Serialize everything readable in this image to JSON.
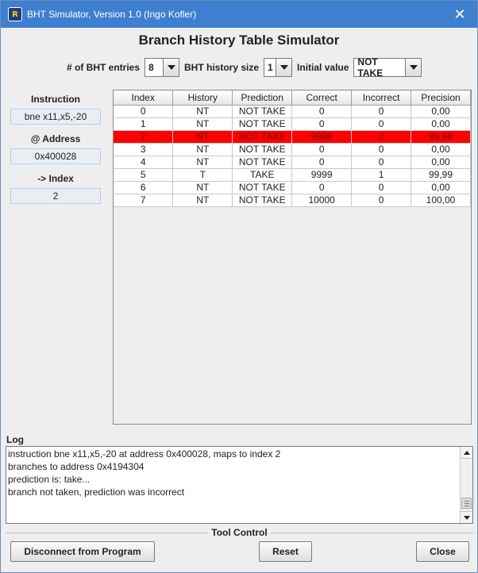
{
  "window": {
    "title": "BHT Simulator, Version 1.0 (Ingo Kofler)",
    "close_glyph": "✕"
  },
  "heading": "Branch History Table Simulator",
  "options": {
    "bht_entries_label": "# of BHT entries",
    "bht_entries_value": "8",
    "history_size_label": "BHT history size",
    "history_size_value": "1",
    "initial_value_label": "Initial value",
    "initial_value_value": "NOT TAKE"
  },
  "left_panel": {
    "instruction_label": "Instruction",
    "instruction_value": "bne x11,x5,-20",
    "address_label": "@ Address",
    "address_value": "0x400028",
    "index_label": "-> Index",
    "index_value": "2"
  },
  "table": {
    "headers": [
      "Index",
      "History",
      "Prediction",
      "Correct",
      "Incorrect",
      "Precision"
    ],
    "selected_row": 2,
    "selected_color": "#ff0000",
    "rows": [
      [
        "0",
        "NT",
        "NOT TAKE",
        "0",
        "0",
        "0,00"
      ],
      [
        "1",
        "NT",
        "NOT TAKE",
        "0",
        "0",
        "0,00"
      ],
      [
        "2",
        "NT",
        "NOT TAKE",
        "9998",
        "2",
        "99,98"
      ],
      [
        "3",
        "NT",
        "NOT TAKE",
        "0",
        "0",
        "0,00"
      ],
      [
        "4",
        "NT",
        "NOT TAKE",
        "0",
        "0",
        "0,00"
      ],
      [
        "5",
        "T",
        "TAKE",
        "9999",
        "1",
        "99,99"
      ],
      [
        "6",
        "NT",
        "NOT TAKE",
        "0",
        "0",
        "0,00"
      ],
      [
        "7",
        "NT",
        "NOT TAKE",
        "10000",
        "0",
        "100,00"
      ]
    ]
  },
  "log": {
    "label": "Log",
    "lines": [
      "instruction bne x11,x5,-20 at address 0x400028, maps to index 2",
      "branches to address 0x4194304",
      "prediction is: take...",
      "branch not taken, prediction was incorrect"
    ]
  },
  "tool_control": {
    "title": "Tool Control",
    "disconnect_label": "Disconnect from Program",
    "reset_label": "Reset",
    "close_label": "Close"
  }
}
